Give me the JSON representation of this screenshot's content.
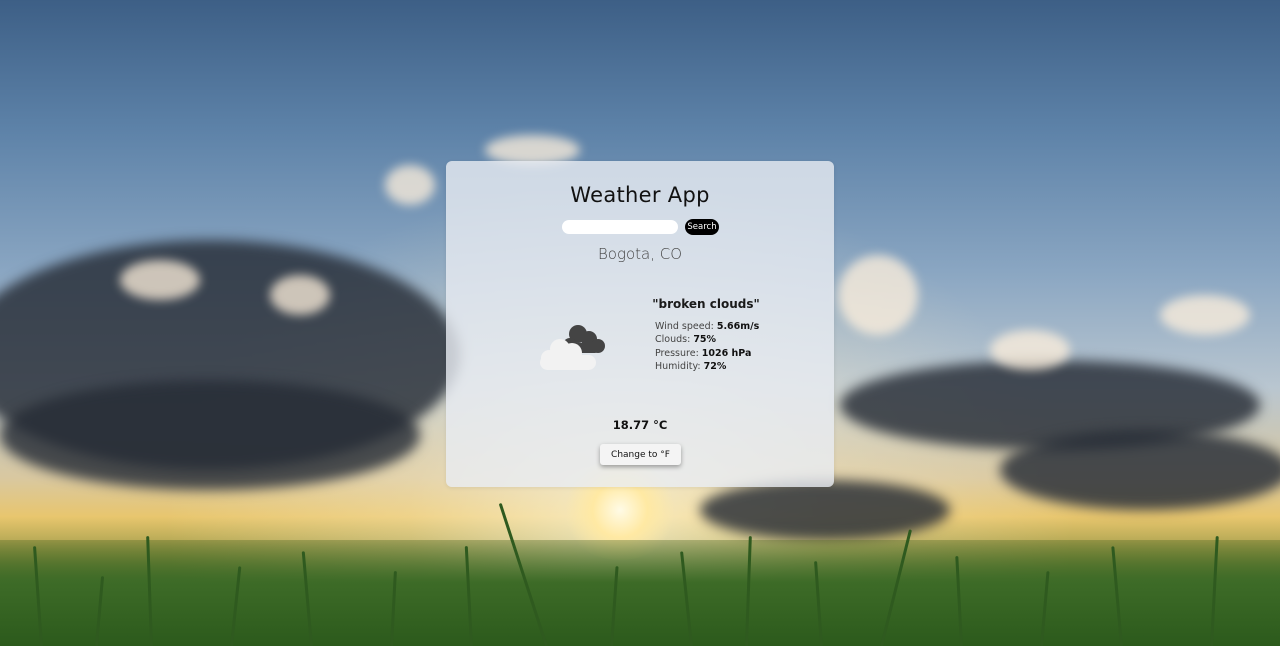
{
  "app": {
    "title": "Weather App"
  },
  "search": {
    "value": "",
    "placeholder": "",
    "button_label": "Search"
  },
  "location": {
    "city": "Bogota, CO"
  },
  "weather": {
    "description": "\"broken clouds\"",
    "icon": "broken-clouds-icon",
    "details": [
      {
        "label": "Wind speed: ",
        "value": "5.66m/s"
      },
      {
        "label": "Clouds: ",
        "value": "75%"
      },
      {
        "label": "Pressure: ",
        "value": "1026 hPa"
      },
      {
        "label": "Humidity: ",
        "value": "72%"
      }
    ],
    "temperature": "18.77 °C"
  },
  "unit_toggle": {
    "label": "Change to °F"
  },
  "colors": {
    "card_background": "#e8ecf2",
    "search_button": "#000000",
    "icon_dark_cloud": "#444444",
    "icon_light_cloud": "#f2f2f2"
  }
}
